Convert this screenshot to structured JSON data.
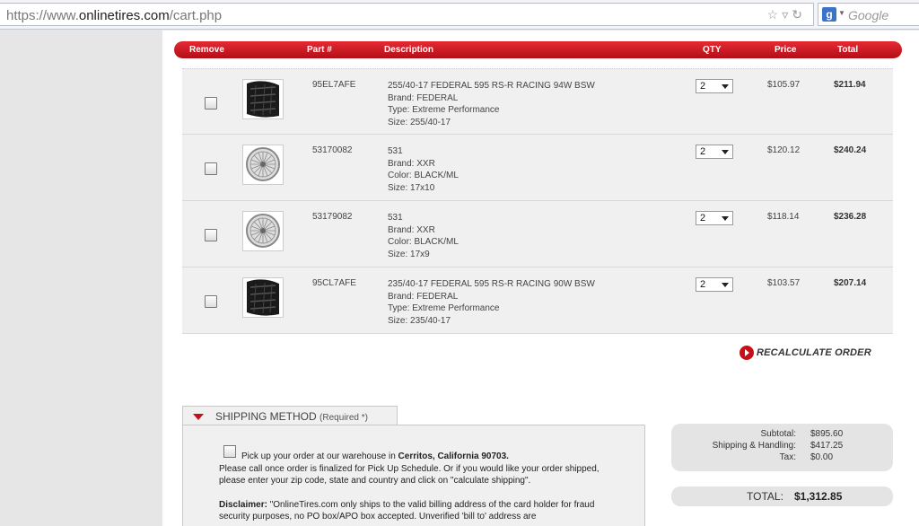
{
  "browser": {
    "url_prefix": "https://www.",
    "url_domain": "onlinetires.com",
    "url_path": "/cart.php",
    "search_placeholder": "Google"
  },
  "header": {
    "remove": "Remove",
    "part": "Part #",
    "description": "Description",
    "qty": "QTY",
    "price": "Price",
    "total": "Total"
  },
  "items": [
    {
      "part": "95EL7AFE",
      "title": "255/40-17 FEDERAL 595 RS-R RACING 94W BSW",
      "line2": "Brand: FEDERAL",
      "line3": "Type: Extreme Performance",
      "line4": "Size: 255/40-17",
      "qty": "2",
      "price": "$105.97",
      "total": "$211.94",
      "image": "tire-icon"
    },
    {
      "part": "53170082",
      "title": "531",
      "line2": "Brand: XXR",
      "line3": "Color: BLACK/ML",
      "line4": "Size: 17x10",
      "qty": "2",
      "price": "$120.12",
      "total": "$240.24",
      "image": "wheel-icon"
    },
    {
      "part": "53179082",
      "title": "531",
      "line2": "Brand: XXR",
      "line3": "Color: BLACK/ML",
      "line4": "Size: 17x9",
      "qty": "2",
      "price": "$118.14",
      "total": "$236.28",
      "image": "wheel-icon"
    },
    {
      "part": "95CL7AFE",
      "title": "235/40-17 FEDERAL 595 RS-R RACING 90W BSW",
      "line2": "Brand: FEDERAL",
      "line3": "Type: Extreme Performance",
      "line4": "Size: 235/40-17",
      "qty": "2",
      "price": "$103.57",
      "total": "$207.14",
      "image": "tire-icon"
    }
  ],
  "recalculate_label": "RECALCULATE ORDER",
  "shipping": {
    "title": "SHIPPING METHOD",
    "required": "(Required *)",
    "pickup_prefix": "Pick up your order at our warehouse in ",
    "pickup_location": "Cerritos, California 90703.",
    "pickup_note": "Please call once order is finalized for Pick Up Schedule. Or if you would like your order shipped, please enter your zip code, state and country and click on \"calculate shipping\".",
    "disclaimer_label": "Disclaimer:",
    "disclaimer_text": " \"OnlineTires.com only ships to the valid billing address of the card holder for fraud security purposes, no PO box/APO box accepted. Unverified 'bill to' address are"
  },
  "summary": {
    "subtotal_label": "Subtotal:",
    "subtotal": "$895.60",
    "shipping_label": "Shipping & Handling:",
    "shipping": "$417.25",
    "tax_label": "Tax:",
    "tax": "$0.00",
    "total_label": "TOTAL:",
    "total": "$1,312.85"
  },
  "colors": {
    "accent_red": "#c5101a",
    "row_bg": "#f0f0f0"
  }
}
